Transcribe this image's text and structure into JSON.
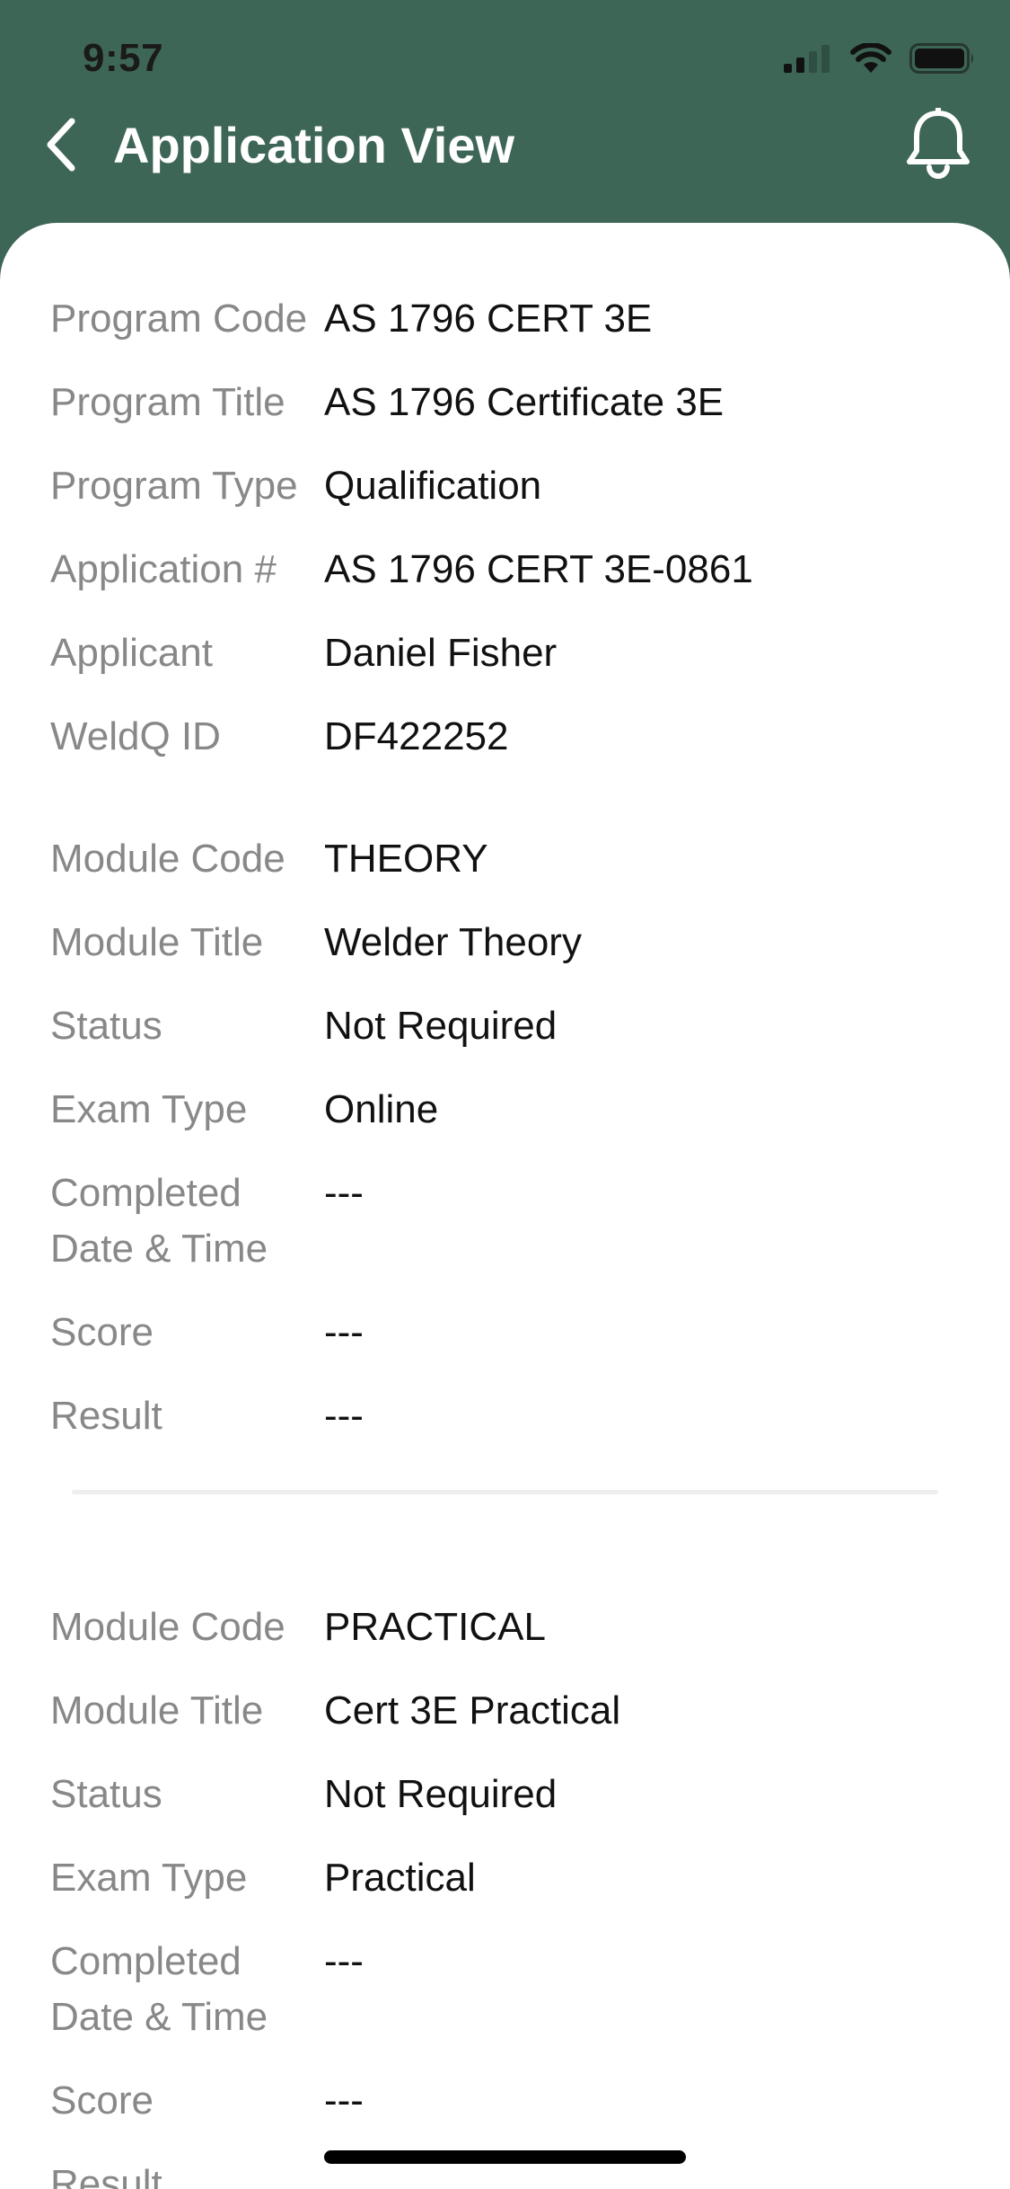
{
  "status_bar": {
    "time": "9:57",
    "icons": [
      "cellular-signal-icon",
      "wifi-icon",
      "battery-icon"
    ]
  },
  "header": {
    "title": "Application View",
    "back_icon": "chevron-left-icon",
    "notification_icon": "bell-icon",
    "background_color": "#3e6656"
  },
  "program": {
    "rows": [
      {
        "label": "Program Code",
        "value": "AS 1796 CERT 3E"
      },
      {
        "label": "Program Title",
        "value": "AS 1796 Certificate 3E"
      },
      {
        "label": "Program Type",
        "value": "Qualification"
      },
      {
        "label": "Application #",
        "value": "AS 1796 CERT 3E-0861"
      },
      {
        "label": "Applicant",
        "value": "Daniel Fisher"
      },
      {
        "label": "WeldQ ID",
        "value": "DF422252"
      }
    ]
  },
  "modules": [
    {
      "rows": [
        {
          "label": "Module Code",
          "value": "THEORY"
        },
        {
          "label": "Module Title",
          "value": "Welder Theory"
        },
        {
          "label": "Status",
          "value": "Not Required"
        },
        {
          "label": "Exam Type",
          "value": "Online"
        },
        {
          "label": "Completed Date & Time",
          "value": "---"
        },
        {
          "label": "Score",
          "value": "---"
        },
        {
          "label": "Result",
          "value": "---"
        }
      ]
    },
    {
      "rows": [
        {
          "label": "Module Code",
          "value": "PRACTICAL"
        },
        {
          "label": "Module Title",
          "value": "Cert 3E Practical"
        },
        {
          "label": "Status",
          "value": "Not Required"
        },
        {
          "label": "Exam Type",
          "value": "Practical"
        },
        {
          "label": "Completed Date & Time",
          "value": "---"
        },
        {
          "label": "Score",
          "value": "---"
        },
        {
          "label": "Result",
          "value": ""
        }
      ]
    }
  ]
}
